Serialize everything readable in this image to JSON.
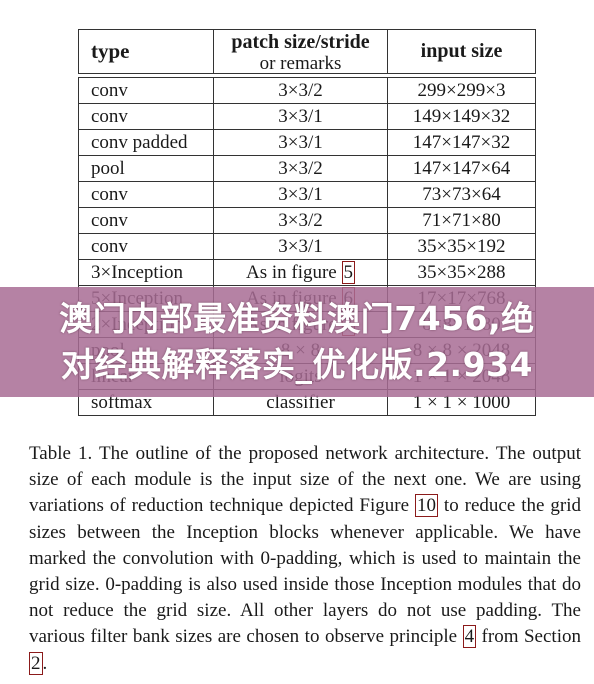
{
  "table": {
    "headers": {
      "type": "type",
      "patch": "patch size/stride",
      "patch_sub": "or remarks",
      "input": "input size"
    },
    "rows": [
      {
        "type": "conv",
        "patch": "3×3/2",
        "input": "299×299×3"
      },
      {
        "type": "conv",
        "patch": "3×3/1",
        "input": "149×149×32"
      },
      {
        "type": "conv padded",
        "patch": "3×3/1",
        "input": "147×147×32"
      },
      {
        "type": "pool",
        "patch": "3×3/2",
        "input": "147×147×64"
      },
      {
        "type": "conv",
        "patch": "3×3/1",
        "input": "73×73×64"
      },
      {
        "type": "conv",
        "patch": "3×3/2",
        "input": "71×71×80"
      },
      {
        "type": "conv",
        "patch": "3×3/1",
        "input": "35×35×192"
      },
      {
        "type": "3×Inception",
        "patch": "As in figure",
        "ref": "5",
        "input": "35×35×288"
      },
      {
        "type": "5×Inception",
        "patch": "As in figure",
        "ref": "6",
        "input": "17×17×768"
      },
      {
        "type": "2×Inception",
        "patch": "As in figure",
        "ref": "7",
        "input": "8×8×1280"
      },
      {
        "type": "pool",
        "patch": "8 × 8",
        "input": "8 × 8 × 2048"
      },
      {
        "type": "linear",
        "patch": "logits",
        "input": "1 × 1 × 2048"
      },
      {
        "type": "softmax",
        "patch": "classifier",
        "input": "1 × 1 × 1000"
      }
    ]
  },
  "caption": {
    "p1": "Table 1. The outline of the proposed network architecture. The output size of each module is the input size of the next one. We are using variations of reduction technique depicted Figure ",
    "ref1": "10",
    "p2": " to reduce the grid sizes between the Inception blocks whenever applicable. We have marked the convolution with 0-padding, which is used to maintain the grid size.  0-padding is also used inside those Inception modules that do not reduce the grid size. All other layers do not use padding. The various filter bank sizes are chosen to observe principle ",
    "ref2": "4",
    "p3": " from Section ",
    "ref3": "2",
    "p4": "."
  },
  "banner": {
    "line1": "澳门内部最准资料澳门7456,绝",
    "line2": "对经典解释落实_优化版.2.934",
    "color": "#b887a8"
  }
}
